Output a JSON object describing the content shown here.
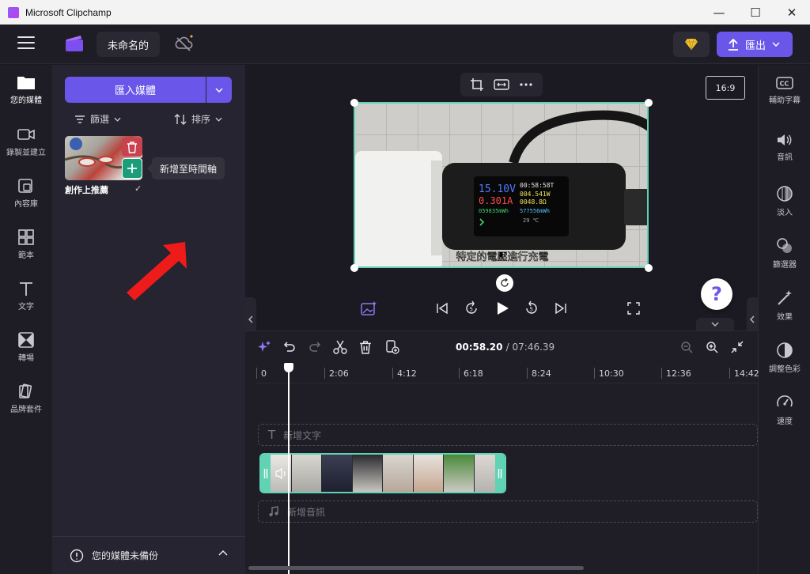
{
  "window": {
    "title": "Microsoft Clipchamp"
  },
  "header": {
    "project_title": "未命名的",
    "export_label": "匯出"
  },
  "left_rail": {
    "items": [
      {
        "label": "您的媒體"
      },
      {
        "label": "錄製並建立"
      },
      {
        "label": "內容庫"
      },
      {
        "label": "範本"
      },
      {
        "label": "文字"
      },
      {
        "label": "轉場"
      },
      {
        "label": "品牌套件"
      }
    ]
  },
  "media_panel": {
    "import_label": "匯入媒體",
    "filter_label": "篩選",
    "sort_label": "排序",
    "media_item_label": "創作上推薦",
    "tooltip": "新增至時間軸",
    "backup_label": "您的媒體未備份"
  },
  "preview": {
    "aspect_ratio": "16:9",
    "subtitle": "特定的電壓進行充電",
    "meter": {
      "voltage": "15.10V",
      "current": "0.301A",
      "time": "00:58:58T",
      "power": "004.541W",
      "resistance": "0048.8Ω",
      "energy": "059835mWh",
      "energy2": "577556mWh",
      "temp": "29 ℃"
    },
    "help_label": "?"
  },
  "right_rail": {
    "items": [
      {
        "label": "輔助字幕"
      },
      {
        "label": "音訊"
      },
      {
        "label": "淡入"
      },
      {
        "label": "篩選器"
      },
      {
        "label": "效果"
      },
      {
        "label": "調整色彩"
      },
      {
        "label": "速度"
      }
    ]
  },
  "timeline": {
    "current_time": "00:58.20",
    "total_time": "/ 07:46.39",
    "ticks": [
      "0",
      "2:06",
      "4:12",
      "6:18",
      "8:24",
      "10:30",
      "12:36",
      "14:42"
    ],
    "add_text_label": "新增文字",
    "add_audio_label": "新增音訊"
  },
  "colors": {
    "accent": "#6a56e8",
    "selection": "#5fd3b3",
    "danger": "#c9424f",
    "add": "#1a9e7a"
  }
}
